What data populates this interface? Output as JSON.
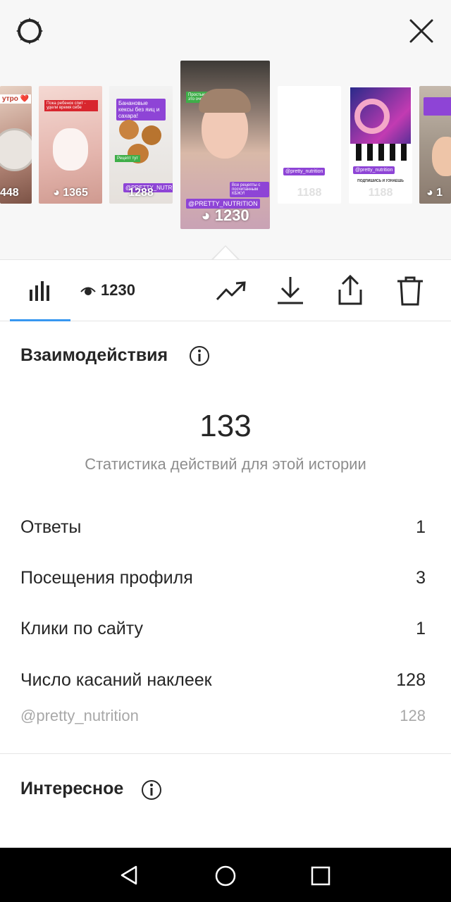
{
  "stories": [
    {
      "title": "утро ❤️",
      "views": "448"
    },
    {
      "title": "Пока ребенок спит - удели время себе",
      "views": "1365"
    },
    {
      "title": "Банановые кексы без яиц и сахара!",
      "sticker": "Рецепт тут",
      "handle": "@PRETTY_NUTRITION",
      "views": "1288"
    },
    {
      "title": "Простые рецепты - это очень красиво",
      "caption": "Все рецепты с посчитанным КБЖУ!",
      "handle": "@PRETTY_NUTRITION",
      "views": "1230"
    },
    {
      "handle": "@pretty_nutrition",
      "views": "1188"
    },
    {
      "heading": "ПОДПИШИСЬ И УЗНАЕШЬ",
      "handle": "@pretty_nutrition",
      "views": "1188"
    },
    {
      "views": "1"
    }
  ],
  "toolbar": {
    "views": "1230"
  },
  "interactions": {
    "title": "Взаимодействия",
    "total": "133",
    "subtitle": "Статистика действий для этой истории",
    "rows": [
      {
        "label": "Ответы",
        "value": "1"
      },
      {
        "label": "Посещения профиля",
        "value": "3"
      },
      {
        "label": "Клики по сайту",
        "value": "1"
      },
      {
        "label": "Число касаний наклеек",
        "value": "128"
      }
    ],
    "sub_row": {
      "label": "@pretty_nutrition",
      "value": "128"
    }
  },
  "discovery": {
    "title": "Интересное"
  },
  "colors": {
    "accent": "#3897f0",
    "sticker_purple": "#8e44d6",
    "text": "#262626",
    "muted": "#8e8e8e"
  }
}
